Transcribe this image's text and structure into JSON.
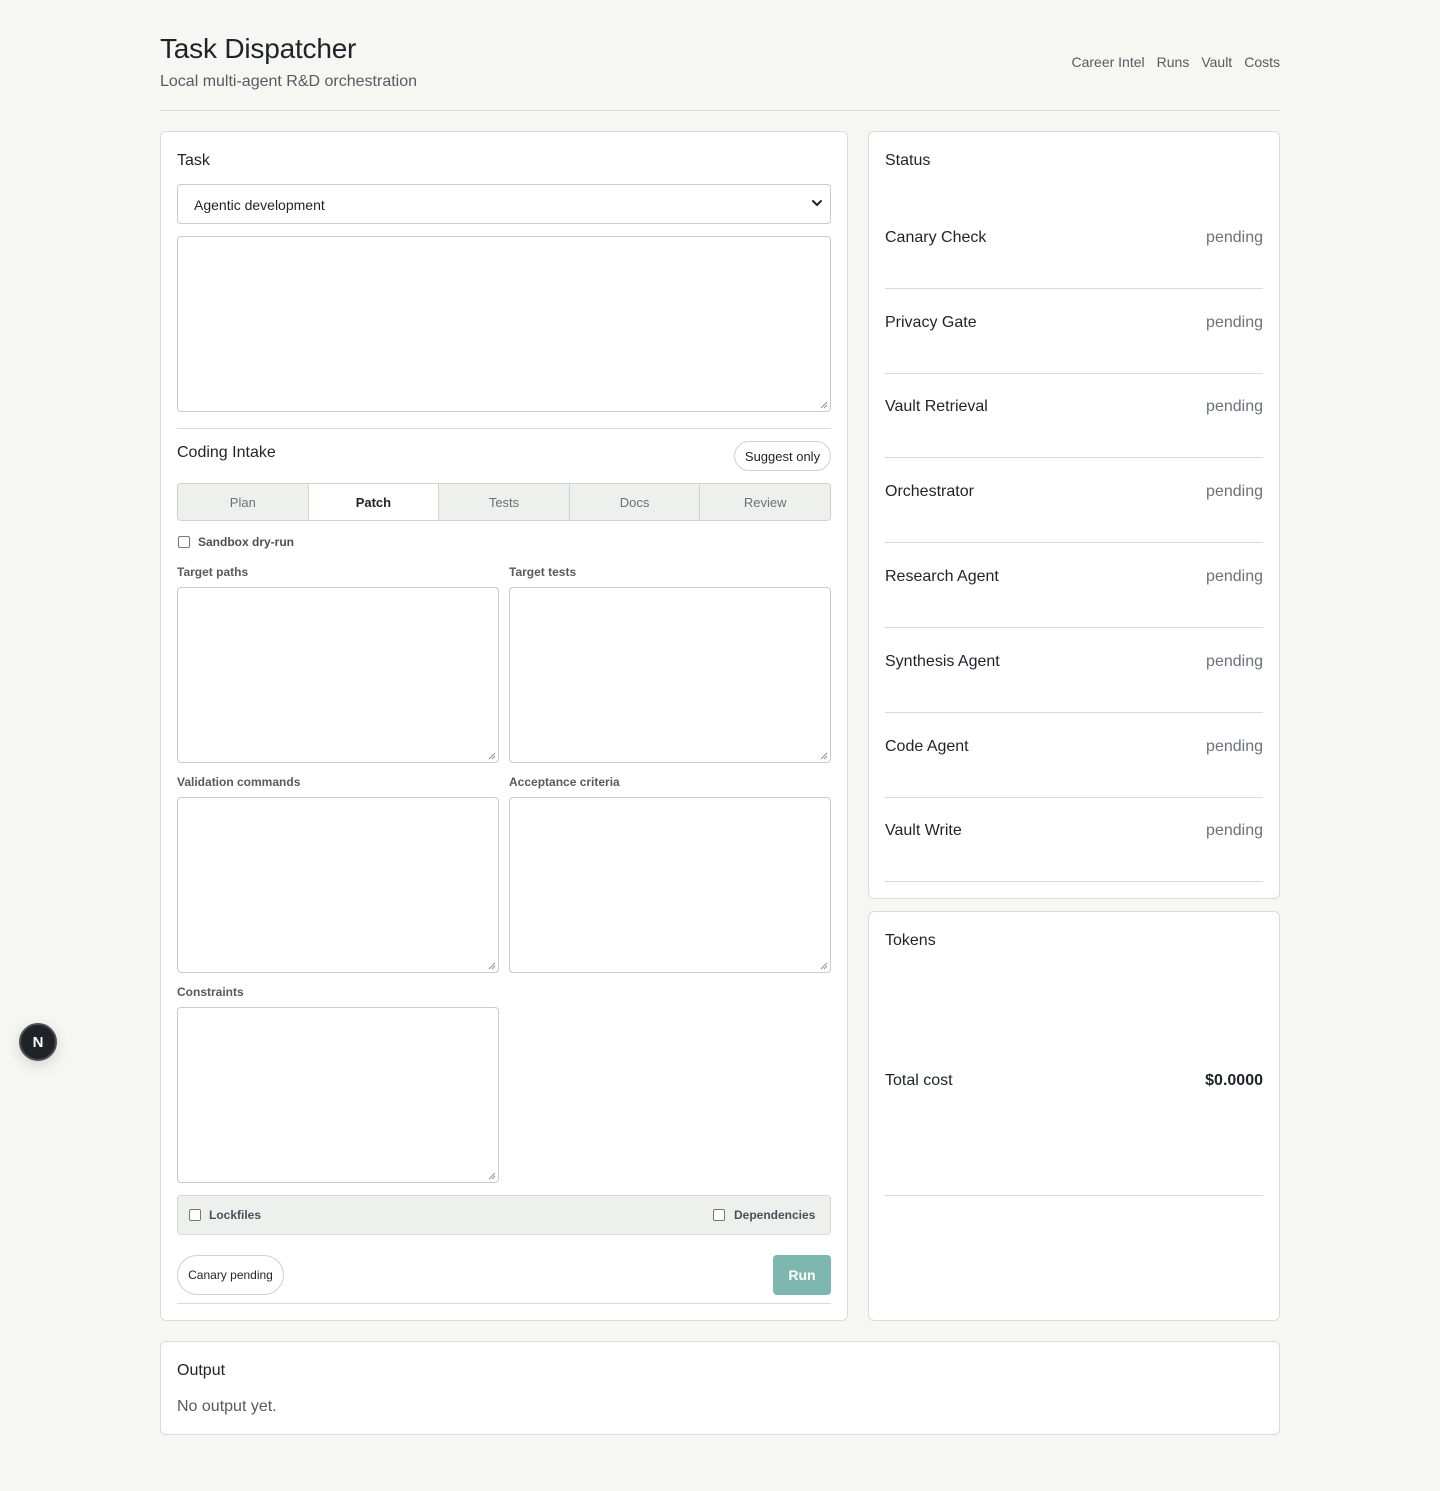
{
  "header": {
    "title": "Task Dispatcher",
    "subtitle": "Local multi-agent R&D orchestration",
    "nav": [
      "Career Intel",
      "Runs",
      "Vault",
      "Costs"
    ]
  },
  "task": {
    "title": "Task",
    "task_type": "Agentic development",
    "prompt_value": ""
  },
  "coding_intake": {
    "title": "Coding Intake",
    "mode_button": "Suggest only",
    "tabs": [
      "Plan",
      "Patch",
      "Tests",
      "Docs",
      "Review"
    ],
    "active_tab": "Patch",
    "sandbox_label": "Sandbox dry-run",
    "sandbox_checked": false,
    "fields": {
      "target_paths": "Target paths",
      "target_tests": "Target tests",
      "validation_commands": "Validation commands",
      "acceptance_criteria": "Acceptance criteria",
      "constraints": "Constraints"
    },
    "lockfiles_label": "Lockfiles",
    "dependencies_label": "Dependencies",
    "canary_badge": "Canary pending",
    "run_button": "Run"
  },
  "status": {
    "title": "Status",
    "items": [
      {
        "name": "Canary Check",
        "state": "pending"
      },
      {
        "name": "Privacy Gate",
        "state": "pending"
      },
      {
        "name": "Vault Retrieval",
        "state": "pending"
      },
      {
        "name": "Orchestrator",
        "state": "pending"
      },
      {
        "name": "Research Agent",
        "state": "pending"
      },
      {
        "name": "Synthesis Agent",
        "state": "pending"
      },
      {
        "name": "Code Agent",
        "state": "pending"
      },
      {
        "name": "Vault Write",
        "state": "pending"
      }
    ]
  },
  "tokens": {
    "title": "Tokens",
    "total_cost_label": "Total cost",
    "total_cost_value": "$0.0000"
  },
  "output": {
    "title": "Output",
    "text": "No output yet."
  },
  "dev_badge": "N",
  "colors": {
    "accent": "#7db7b0",
    "background": "#f6f6f3"
  }
}
